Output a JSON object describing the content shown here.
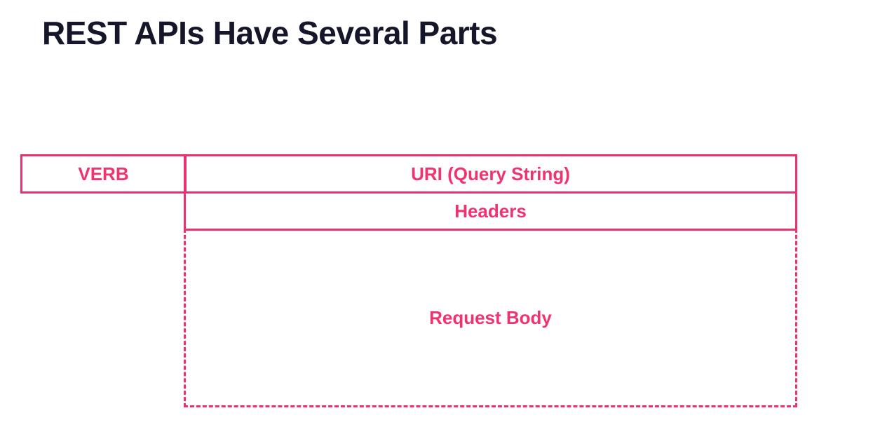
{
  "title": "REST APIs Have Several Parts",
  "diagram": {
    "verb": "VERB",
    "uri": "URI (Query String)",
    "headers": "Headers",
    "body": "Request Body"
  },
  "colors": {
    "title": "#151629",
    "accent": "#e8336f",
    "accent_text": "#f0336f"
  }
}
